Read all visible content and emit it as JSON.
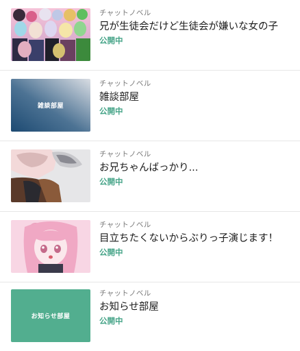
{
  "colors": {
    "status_green": "#46a488",
    "thumb_teal": "#52ae8f"
  },
  "items": [
    {
      "category": "チャットノベル",
      "title": "兄が生徒会だけど生徒会が嫌いな女の子",
      "status": "公開中",
      "thumb_label": ""
    },
    {
      "category": "チャットノベル",
      "title": "雑談部屋",
      "status": "公開中",
      "thumb_label": "雑談部屋"
    },
    {
      "category": "チャットノベル",
      "title": "お兄ちゃんばっかり...",
      "status": "公開中",
      "thumb_label": ""
    },
    {
      "category": "チャットノベル",
      "title": "目立ちたくないからぶりっ子演じます！",
      "status": "公開中",
      "thumb_label": ""
    },
    {
      "category": "チャットノベル",
      "title": "お知らせ部屋",
      "status": "公開中",
      "thumb_label": "お知らせ部屋"
    }
  ]
}
